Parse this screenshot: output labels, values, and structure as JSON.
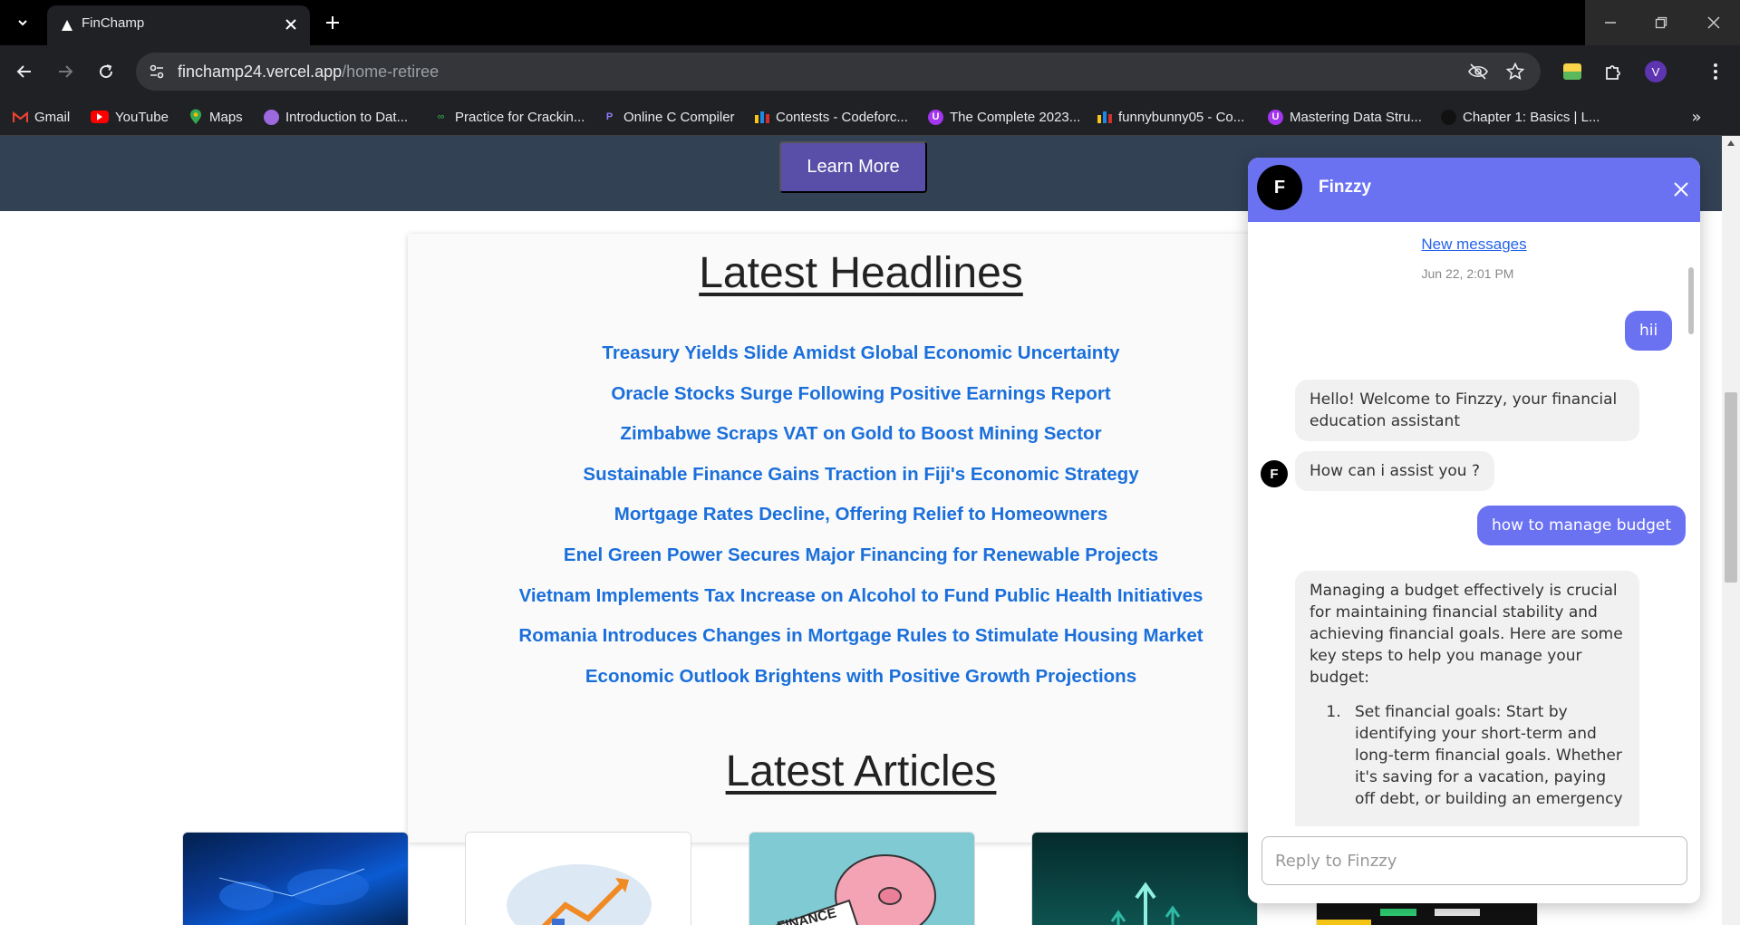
{
  "browser": {
    "tab": {
      "title": "FinChamp"
    },
    "url": {
      "host": "finchamp24.vercel.app",
      "path": "/home-retiree"
    },
    "bookmarks": [
      {
        "label": "Gmail",
        "icon": "gmail-icon",
        "color": "#ea4335"
      },
      {
        "label": "YouTube",
        "icon": "youtube-icon",
        "color": "#ff0000"
      },
      {
        "label": "Maps",
        "icon": "maps-icon",
        "color": "#34a853"
      },
      {
        "label": "Introduction to Dat...",
        "icon": "avatar-icon",
        "color": "#9c6ade"
      },
      {
        "label": "Practice for Crackin...",
        "icon": "gfg-icon",
        "color": "#2f8d46"
      },
      {
        "label": "Online C Compiler",
        "icon": "programiz-icon",
        "color": "#6a5acd"
      },
      {
        "label": "Contests - Codeforc...",
        "icon": "codeforces-icon",
        "color": "#f5c518"
      },
      {
        "label": "The Complete 2023...",
        "icon": "udemy-icon",
        "color": "#a435f0"
      },
      {
        "label": "funnybunny05 - Co...",
        "icon": "codeforces-icon",
        "color": "#f5c518"
      },
      {
        "label": "Mastering Data Stru...",
        "icon": "udemy-icon",
        "color": "#a435f0"
      },
      {
        "label": "Chapter 1: Basics | L...",
        "icon": "page-icon",
        "color": "#222222"
      }
    ],
    "profile_initial": "V"
  },
  "page": {
    "learn_more_label": "Learn More",
    "headlines_title": "Latest Headlines",
    "headlines": [
      "Treasury Yields Slide Amidst Global Economic Uncertainty",
      "Oracle Stocks Surge Following Positive Earnings Report",
      "Zimbabwe Scraps VAT on Gold to Boost Mining Sector",
      "Sustainable Finance Gains Traction in Fiji's Economic Strategy",
      "Mortgage Rates Decline, Offering Relief to Homeowners",
      "Enel Green Power Secures Major Financing for Renewable Projects",
      "Vietnam Implements Tax Increase on Alcohol to Fund Public Health Initiatives",
      "Romania Introduces Changes in Mortgage Rules to Stimulate Housing Market",
      "Economic Outlook Brightens with Positive Growth Projections"
    ],
    "articles_title": "Latest Articles",
    "article_card3_text": "FINANCE",
    "colors": {
      "hero_band": "#334155",
      "button": "#5a4fa8",
      "headline_link": "#1a6fdb"
    }
  },
  "chat": {
    "avatar_initial": "F",
    "name": "Finzzy",
    "new_messages_label": "New messages",
    "timestamp": "Jun 22, 2:01 PM",
    "messages": [
      {
        "from": "user",
        "text": "hii"
      },
      {
        "from": "bot",
        "text": "Hello! Welcome to Finzzy, your financial education assistant"
      },
      {
        "from": "bot",
        "text": "How can i assist you ?"
      },
      {
        "from": "user",
        "text": "how to manage budget"
      },
      {
        "from": "bot",
        "text": "Managing a budget effectively is crucial for maintaining financial stability and achieving financial goals. Here are some key steps to help you manage your budget:",
        "list_item": "Set financial goals: Start by identifying your short-term and long-term financial goals. Whether it's saving for a vacation, paying off debt, or building an emergency"
      }
    ],
    "reply_placeholder": "Reply to Finzzy",
    "accent": "#6b72f2"
  }
}
